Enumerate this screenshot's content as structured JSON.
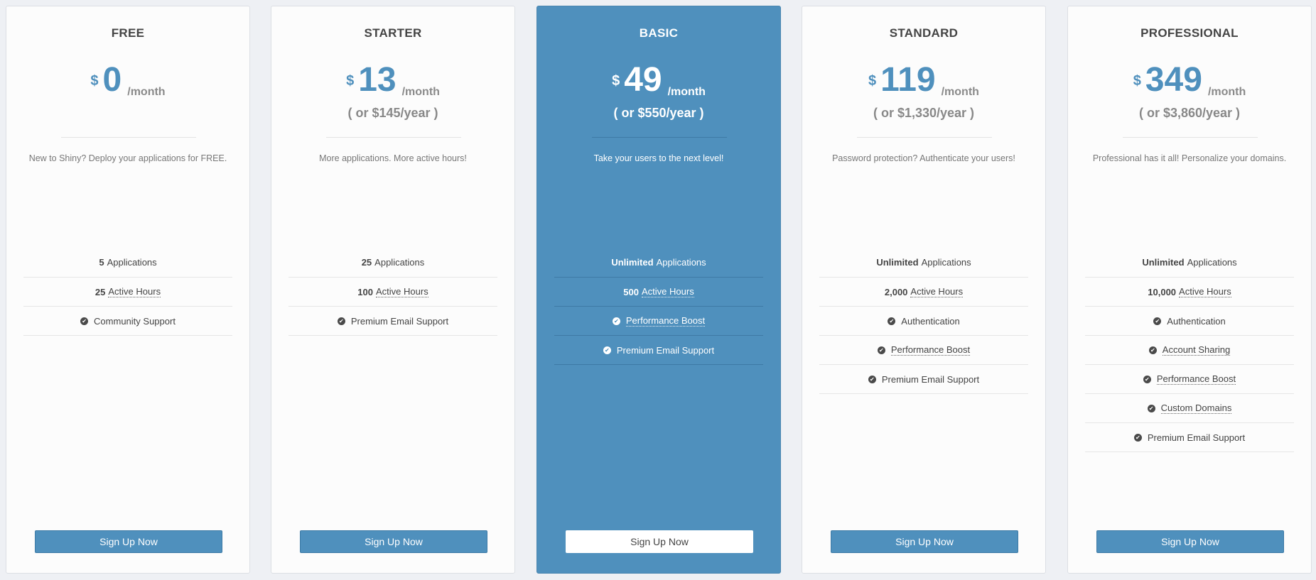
{
  "plans": [
    {
      "name": "FREE",
      "currency": "$",
      "amount": "0",
      "period": "/month",
      "yearly": "",
      "tagline": "New to Shiny? Deploy your applications for FREE.",
      "features": [
        {
          "bold": "5",
          "text": "Applications",
          "dotted": false,
          "check": false
        },
        {
          "bold": "25",
          "text": "Active Hours",
          "dotted": true,
          "check": false
        },
        {
          "bold": "",
          "text": "Community Support",
          "dotted": false,
          "check": true
        }
      ],
      "button": "Sign Up Now"
    },
    {
      "name": "STARTER",
      "currency": "$",
      "amount": "13",
      "period": "/month",
      "yearly": "( or $145/year )",
      "tagline": "More applications. More active hours!",
      "features": [
        {
          "bold": "25",
          "text": "Applications",
          "dotted": false,
          "check": false
        },
        {
          "bold": "100",
          "text": "Active Hours",
          "dotted": true,
          "check": false
        },
        {
          "bold": "",
          "text": "Premium Email Support",
          "dotted": false,
          "check": true
        }
      ],
      "button": "Sign Up Now"
    },
    {
      "name": "BASIC",
      "currency": "$",
      "amount": "49",
      "period": "/month",
      "yearly": "( or $550/year )",
      "tagline": "Take your users to the next level!",
      "features": [
        {
          "bold": "Unlimited",
          "text": "Applications",
          "dotted": false,
          "check": false
        },
        {
          "bold": "500",
          "text": "Active Hours",
          "dotted": true,
          "check": false
        },
        {
          "bold": "",
          "text": "Performance Boost",
          "dotted": true,
          "check": true
        },
        {
          "bold": "",
          "text": "Premium Email Support",
          "dotted": false,
          "check": true
        }
      ],
      "button": "Sign Up Now"
    },
    {
      "name": "STANDARD",
      "currency": "$",
      "amount": "119",
      "period": "/month",
      "yearly": "( or $1,330/year )",
      "tagline": "Password protection? Authenticate your users!",
      "features": [
        {
          "bold": "Unlimited",
          "text": "Applications",
          "dotted": false,
          "check": false
        },
        {
          "bold": "2,000",
          "text": "Active Hours",
          "dotted": true,
          "check": false
        },
        {
          "bold": "",
          "text": "Authentication",
          "dotted": false,
          "check": true
        },
        {
          "bold": "",
          "text": "Performance Boost",
          "dotted": true,
          "check": true
        },
        {
          "bold": "",
          "text": "Premium Email Support",
          "dotted": false,
          "check": true
        }
      ],
      "button": "Sign Up Now"
    },
    {
      "name": "PROFESSIONAL",
      "currency": "$",
      "amount": "349",
      "period": "/month",
      "yearly": "( or $3,860/year )",
      "tagline": "Professional has it all! Personalize your domains.",
      "features": [
        {
          "bold": "Unlimited",
          "text": "Applications",
          "dotted": false,
          "check": false
        },
        {
          "bold": "10,000",
          "text": "Active Hours",
          "dotted": true,
          "check": false
        },
        {
          "bold": "",
          "text": "Authentication",
          "dotted": false,
          "check": true
        },
        {
          "bold": "",
          "text": "Account Sharing",
          "dotted": true,
          "check": true
        },
        {
          "bold": "",
          "text": "Performance Boost",
          "dotted": true,
          "check": true
        },
        {
          "bold": "",
          "text": "Custom Domains",
          "dotted": true,
          "check": true
        },
        {
          "bold": "",
          "text": "Premium Email Support",
          "dotted": false,
          "check": true
        }
      ],
      "button": "Sign Up Now"
    }
  ],
  "featured_plan": "BASIC",
  "colors": {
    "accent": "#4f90bd",
    "page_background": "#eef0f4",
    "card_background": "#fcfcfc"
  },
  "icons": {
    "feature_check": "check-circle-icon"
  }
}
